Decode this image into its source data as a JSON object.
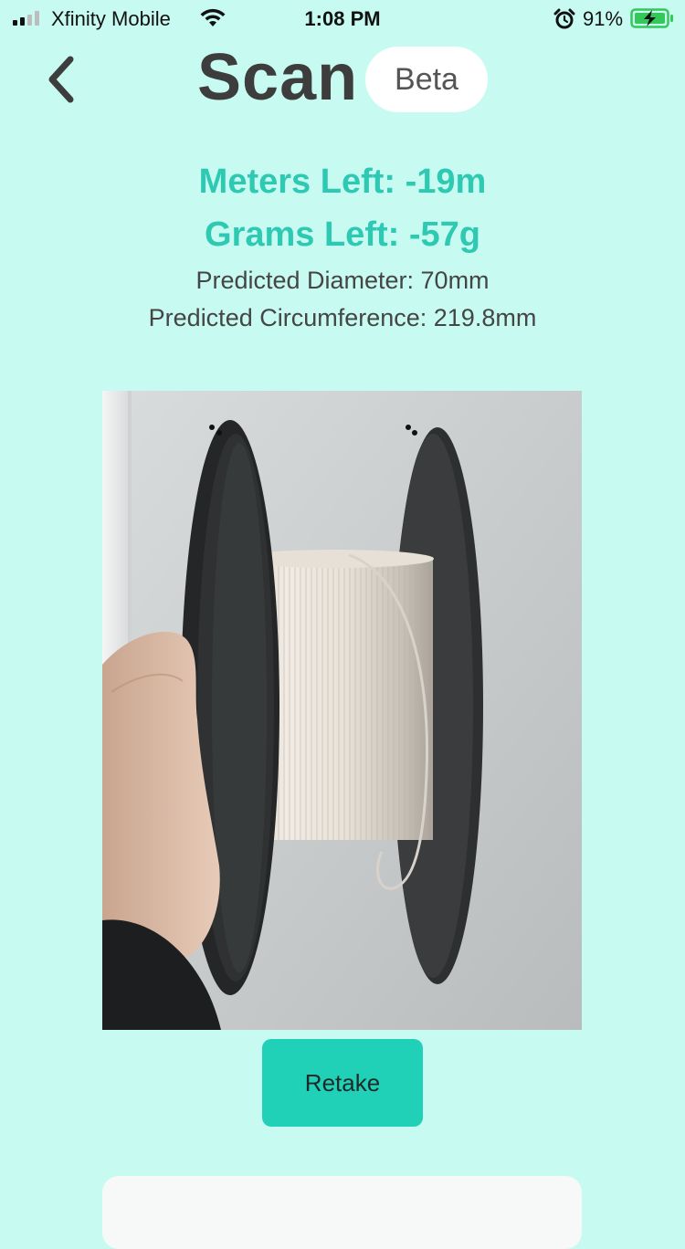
{
  "status_bar": {
    "carrier": "Xfinity Mobile",
    "time": "1:08 PM",
    "battery_percent": "91%",
    "icons": [
      "signal-icon",
      "wifi-icon",
      "alarm-icon",
      "battery-charging-icon"
    ]
  },
  "header": {
    "title": "Scan",
    "badge": "Beta",
    "back_icon": "chevron-left-icon"
  },
  "stats": {
    "meters_left": "Meters Left: -19m",
    "grams_left": "Grams Left: -57g",
    "predicted_diameter": "Predicted Diameter: 70mm",
    "predicted_circumference": "Predicted Circumference: 219.8mm"
  },
  "photo": {
    "subject": "filament-spool-photo"
  },
  "actions": {
    "retake_label": "Retake"
  },
  "colors": {
    "background": "#c7fbf1",
    "accent": "#2ec9b2",
    "button": "#20d1b8",
    "title": "#3d3d3d"
  }
}
